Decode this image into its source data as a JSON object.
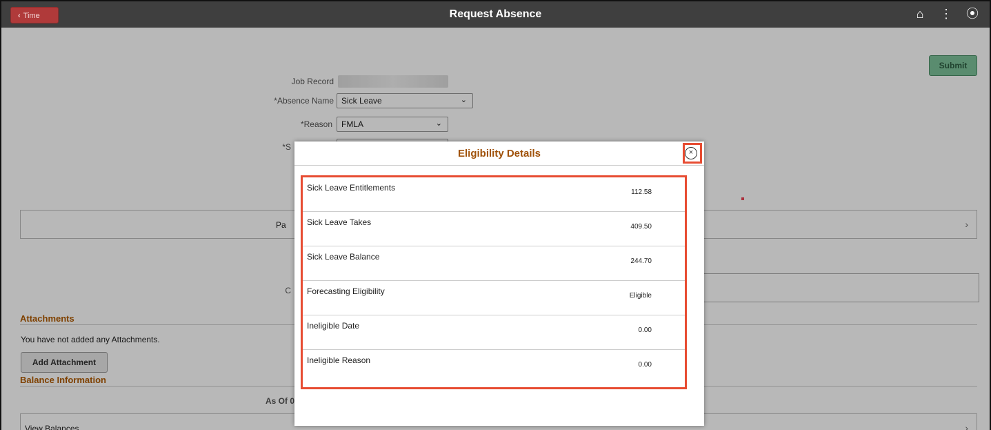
{
  "header": {
    "back_label": "Time",
    "title": "Request Absence",
    "icons": [
      "home-icon",
      "more-icon",
      "compass-icon"
    ]
  },
  "toolbar": {
    "submit_label": "Submit"
  },
  "form": {
    "job_record_label": "Job Record",
    "absence_name_label": "*Absence Name",
    "absence_name_value": "Sick Leave",
    "reason_label": "*Reason",
    "reason_value": "FMLA",
    "partial_start_label": "*S",
    "partial_label": "Pa",
    "comments_label": "C"
  },
  "attachments": {
    "heading": "Attachments",
    "empty_text": "You have not added any Attachments.",
    "add_label": "Add Attachment"
  },
  "balance": {
    "heading": "Balance Information",
    "as_of_label": "As Of 0",
    "view_label": "View Balances"
  },
  "modal": {
    "title": "Eligibility Details",
    "rows": [
      {
        "label": "Sick Leave Entitlements",
        "value": "112.58"
      },
      {
        "label": "Sick Leave Takes",
        "value": "409.50"
      },
      {
        "label": "Sick Leave Balance",
        "value": "244.70"
      },
      {
        "label": "Forecasting Eligibility",
        "value": "Eligible"
      },
      {
        "label": "Ineligible Date",
        "value": "0.00"
      },
      {
        "label": "Ineligible Reason",
        "value": "0.00"
      }
    ]
  },
  "colors": {
    "header_bg": "#3f3f3f",
    "back_button": "#b03a3a",
    "submit_button": "#7dc29a",
    "section_heading": "#b05a00",
    "highlight": "#e74c32"
  }
}
